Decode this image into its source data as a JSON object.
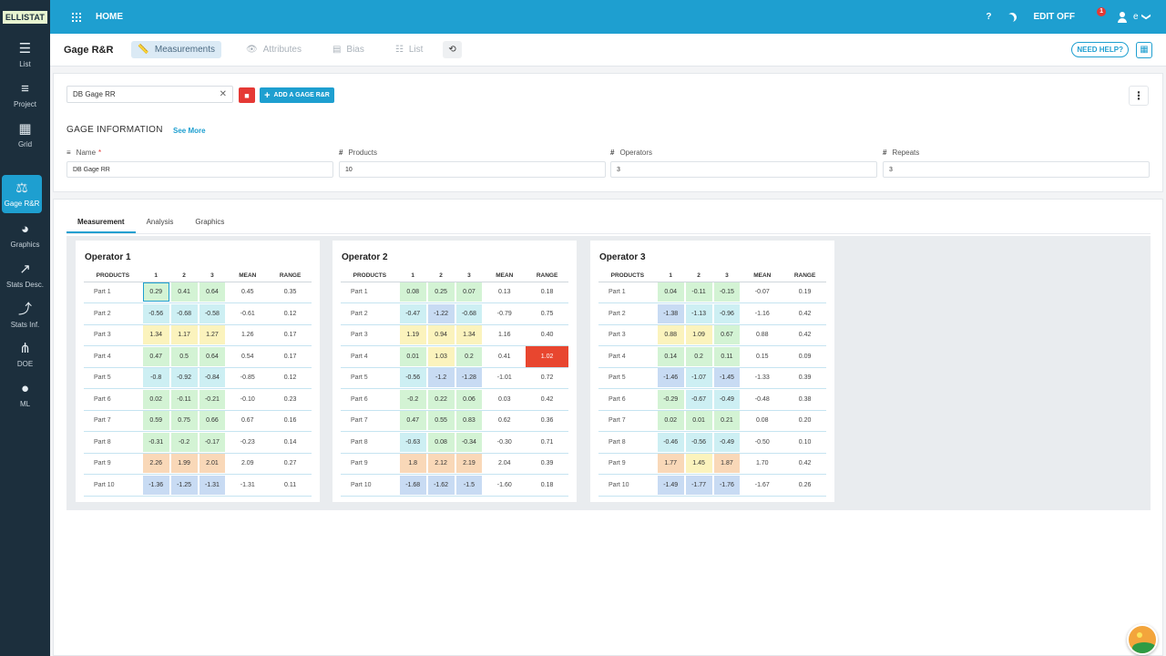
{
  "brand": "ELLISTAT",
  "topbar": {
    "home": "HOME",
    "help": "?",
    "edit_off": "EDIT OFF",
    "notif_count": "1",
    "user": "e",
    "chevron": "❯"
  },
  "sidebar": [
    {
      "label": "List",
      "icon": "list-icon",
      "glyph": "☰"
    },
    {
      "label": "Project",
      "icon": "menu-icon",
      "glyph": "≡"
    },
    {
      "label": "Grid",
      "icon": "grid-table-icon",
      "glyph": "▦"
    },
    {
      "label": "Gage R&R",
      "icon": "scale-icon",
      "glyph": "⚖"
    },
    {
      "label": "Graphics",
      "icon": "pie-chart-icon",
      "glyph": "◕"
    },
    {
      "label": "Stats Desc.",
      "icon": "line-chart-icon",
      "glyph": "↗"
    },
    {
      "label": "Stats Inf.",
      "icon": "trend-icon",
      "glyph": "⤴"
    },
    {
      "label": "DOE",
      "icon": "hierarchy-icon",
      "glyph": "⋔"
    },
    {
      "label": "ML",
      "icon": "brain-icon",
      "glyph": "●"
    }
  ],
  "page": {
    "title": "Gage R&R",
    "tabs": [
      "Measurements",
      "Attributes",
      "Bias",
      "List"
    ],
    "need_help": "NEED HELP?"
  },
  "gage": {
    "selected": "DB Gage RR",
    "add_label": "ADD A GAGE R&R",
    "section_title": "GAGE INFORMATION",
    "see_more": "See More",
    "fields": [
      {
        "label": "Name",
        "value": "DB Gage RR",
        "prefix": "≡",
        "required": "*"
      },
      {
        "label": "Products",
        "value": "10",
        "prefix": "#",
        "required": ""
      },
      {
        "label": "Operators",
        "value": "3",
        "prefix": "#",
        "required": ""
      },
      {
        "label": "Repeats",
        "value": "3",
        "prefix": "#",
        "required": ""
      }
    ]
  },
  "measure_tabs": [
    "Measurement",
    "Analysis",
    "Graphics"
  ],
  "table_headers": [
    "PRODUCTS",
    "1",
    "2",
    "3",
    "MEAN",
    "RANGE"
  ],
  "operators": [
    {
      "name": "Operator 1",
      "rows": [
        {
          "part": "Part 1",
          "v": [
            "0.29",
            "0.41",
            "0.64"
          ],
          "mean": "0.45",
          "range": "0.35"
        },
        {
          "part": "Part 2",
          "v": [
            "-0.56",
            "-0.68",
            "-0.58"
          ],
          "mean": "-0.61",
          "range": "0.12"
        },
        {
          "part": "Part 3",
          "v": [
            "1.34",
            "1.17",
            "1.27"
          ],
          "mean": "1.26",
          "range": "0.17"
        },
        {
          "part": "Part 4",
          "v": [
            "0.47",
            "0.5",
            "0.64"
          ],
          "mean": "0.54",
          "range": "0.17"
        },
        {
          "part": "Part 5",
          "v": [
            "-0.8",
            "-0.92",
            "-0.84"
          ],
          "mean": "-0.85",
          "range": "0.12"
        },
        {
          "part": "Part 6",
          "v": [
            "0.02",
            "-0.11",
            "-0.21"
          ],
          "mean": "-0.10",
          "range": "0.23"
        },
        {
          "part": "Part 7",
          "v": [
            "0.59",
            "0.75",
            "0.66"
          ],
          "mean": "0.67",
          "range": "0.16"
        },
        {
          "part": "Part 8",
          "v": [
            "-0.31",
            "-0.2",
            "-0.17"
          ],
          "mean": "-0.23",
          "range": "0.14"
        },
        {
          "part": "Part 9",
          "v": [
            "2.26",
            "1.99",
            "2.01"
          ],
          "mean": "2.09",
          "range": "0.27"
        },
        {
          "part": "Part 10",
          "v": [
            "-1.36",
            "-1.25",
            "-1.31"
          ],
          "mean": "-1.31",
          "range": "0.11"
        }
      ]
    },
    {
      "name": "Operator 2",
      "rows": [
        {
          "part": "Part 1",
          "v": [
            "0.08",
            "0.25",
            "0.07"
          ],
          "mean": "0.13",
          "range": "0.18"
        },
        {
          "part": "Part 2",
          "v": [
            "-0.47",
            "-1.22",
            "-0.68"
          ],
          "mean": "-0.79",
          "range": "0.75"
        },
        {
          "part": "Part 3",
          "v": [
            "1.19",
            "0.94",
            "1.34"
          ],
          "mean": "1.16",
          "range": "0.40"
        },
        {
          "part": "Part 4",
          "v": [
            "0.01",
            "1.03",
            "0.2"
          ],
          "mean": "0.41",
          "range": "1.02"
        },
        {
          "part": "Part 5",
          "v": [
            "-0.56",
            "-1.2",
            "-1.28"
          ],
          "mean": "-1.01",
          "range": "0.72"
        },
        {
          "part": "Part 6",
          "v": [
            "-0.2",
            "0.22",
            "0.06"
          ],
          "mean": "0.03",
          "range": "0.42"
        },
        {
          "part": "Part 7",
          "v": [
            "0.47",
            "0.55",
            "0.83"
          ],
          "mean": "0.62",
          "range": "0.36"
        },
        {
          "part": "Part 8",
          "v": [
            "-0.63",
            "0.08",
            "-0.34"
          ],
          "mean": "-0.30",
          "range": "0.71"
        },
        {
          "part": "Part 9",
          "v": [
            "1.8",
            "2.12",
            "2.19"
          ],
          "mean": "2.04",
          "range": "0.39"
        },
        {
          "part": "Part 10",
          "v": [
            "-1.68",
            "-1.62",
            "-1.5"
          ],
          "mean": "-1.60",
          "range": "0.18"
        }
      ]
    },
    {
      "name": "Operator 3",
      "rows": [
        {
          "part": "Part 1",
          "v": [
            "0.04",
            "-0.11",
            "-0.15"
          ],
          "mean": "-0.07",
          "range": "0.19"
        },
        {
          "part": "Part 2",
          "v": [
            "-1.38",
            "-1.13",
            "-0.96"
          ],
          "mean": "-1.16",
          "range": "0.42"
        },
        {
          "part": "Part 3",
          "v": [
            "0.88",
            "1.09",
            "0.67"
          ],
          "mean": "0.88",
          "range": "0.42"
        },
        {
          "part": "Part 4",
          "v": [
            "0.14",
            "0.2",
            "0.11"
          ],
          "mean": "0.15",
          "range": "0.09"
        },
        {
          "part": "Part 5",
          "v": [
            "-1.46",
            "-1.07",
            "-1.45"
          ],
          "mean": "-1.33",
          "range": "0.39"
        },
        {
          "part": "Part 6",
          "v": [
            "-0.29",
            "-0.67",
            "-0.49"
          ],
          "mean": "-0.48",
          "range": "0.38"
        },
        {
          "part": "Part 7",
          "v": [
            "0.02",
            "0.01",
            "0.21"
          ],
          "mean": "0.08",
          "range": "0.20"
        },
        {
          "part": "Part 8",
          "v": [
            "-0.46",
            "-0.56",
            "-0.49"
          ],
          "mean": "-0.50",
          "range": "0.10"
        },
        {
          "part": "Part 9",
          "v": [
            "1.77",
            "1.45",
            "1.87"
          ],
          "mean": "1.70",
          "range": "0.42"
        },
        {
          "part": "Part 10",
          "v": [
            "-1.49",
            "-1.77",
            "-1.76"
          ],
          "mean": "-1.67",
          "range": "0.26"
        }
      ]
    }
  ],
  "highlight": {
    "operator": 1,
    "row": 3,
    "color": "#e8462f"
  },
  "colors": {
    "accent": "#1e9fd0",
    "sidebar": "#1c2f3d",
    "danger": "#e53935"
  }
}
